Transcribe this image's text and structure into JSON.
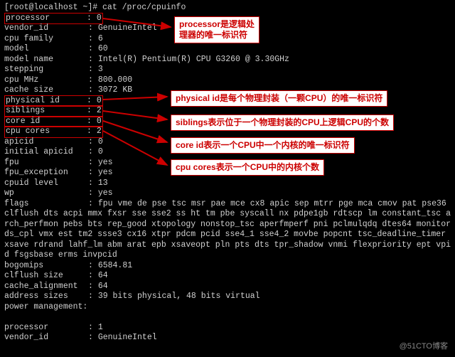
{
  "prompt": "[root@localhost ~]# cat /proc/cpuinfo",
  "fields": {
    "processor": {
      "k": "processor",
      "v": "0"
    },
    "vendor_id": {
      "k": "vendor_id",
      "v": "GenuineIntel"
    },
    "cpu_family": {
      "k": "cpu family",
      "v": "6"
    },
    "model": {
      "k": "model",
      "v": "60"
    },
    "model_name": {
      "k": "model name",
      "v": "Intel(R) Pentium(R) CPU G3260 @ 3.30GHz"
    },
    "stepping": {
      "k": "stepping",
      "v": "3"
    },
    "cpu_mhz": {
      "k": "cpu MHz",
      "v": "800.000"
    },
    "cache_size": {
      "k": "cache size",
      "v": "3072 KB"
    },
    "physical_id": {
      "k": "physical id",
      "v": "0"
    },
    "siblings": {
      "k": "siblings",
      "v": "2"
    },
    "core_id": {
      "k": "core id",
      "v": "0"
    },
    "cpu_cores": {
      "k": "cpu cores",
      "v": "2"
    },
    "apicid": {
      "k": "apicid",
      "v": "0"
    },
    "initial_apicid": {
      "k": "initial apicid",
      "v": "0"
    },
    "fpu": {
      "k": "fpu",
      "v": "yes"
    },
    "fpu_exception": {
      "k": "fpu_exception",
      "v": "yes"
    },
    "cpuid_level": {
      "k": "cpuid level",
      "v": "13"
    },
    "wp": {
      "k": "wp",
      "v": "yes"
    },
    "flags_label": "flags",
    "flags_value": "fpu vme de pse tsc msr pae mce cx8 apic sep mtrr pge mca cmov pat pse36 clflush dts acpi mmx fxsr sse sse2 ss ht tm pbe syscall nx pdpe1gb rdtscp lm constant_tsc arch_perfmon pebs bts rep_good xtopology nonstop_tsc aperfmperf pni pclmulqdq dtes64 monitor ds_cpl vmx est tm2 ssse3 cx16 xtpr pdcm pcid sse4_1 sse4_2 movbe popcnt tsc_deadline_timer xsave rdrand lahf_lm abm arat epb xsaveopt pln pts dts tpr_shadow vnmi flexpriority ept vpid fsgsbase erms invpcid",
    "bogomips": {
      "k": "bogomips",
      "v": "6584.81"
    },
    "clflush_size": {
      "k": "clflush size",
      "v": "64"
    },
    "cache_alignment": {
      "k": "cache_alignment",
      "v": "64"
    },
    "address_sizes": {
      "k": "address sizes",
      "v": "39 bits physical, 48 bits virtual"
    },
    "power_management": {
      "k": "power management:",
      "v": ""
    },
    "processor2": {
      "k": "processor",
      "v": "1"
    },
    "vendor_id2": {
      "k": "vendor_id",
      "v": "GenuineIntel"
    }
  },
  "annotations": {
    "a1": "processor是逻辑处\n理器的唯一标识符",
    "a2": "physical id是每个物理封装（一颗CPU）的唯一标识符",
    "a3": "siblings表示位于一个物理封装的CPU上逻辑CPU的个数",
    "a4": "core id表示一个CPU中一个内核的唯一标识符",
    "a5": "cpu cores表示一个CPU中的内核个数"
  },
  "watermark": "@51CTO博客"
}
